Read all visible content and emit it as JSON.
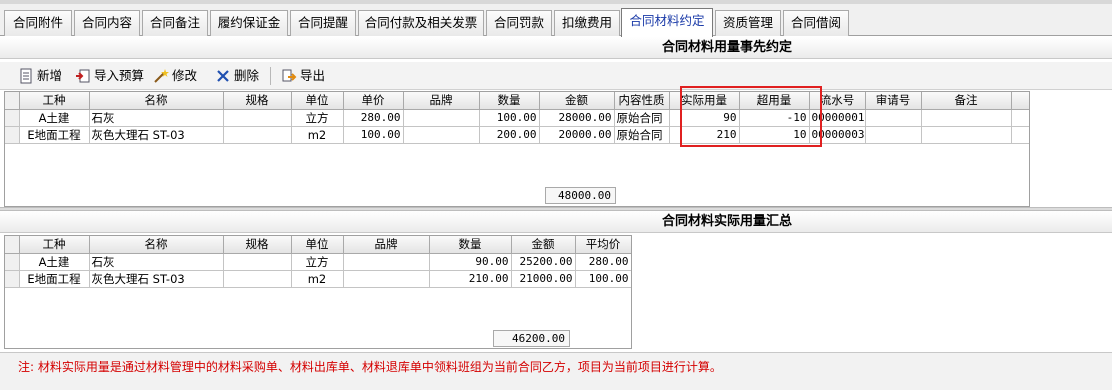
{
  "tabs": [
    {
      "label": "合同附件"
    },
    {
      "label": "合同内容"
    },
    {
      "label": "合同备注"
    },
    {
      "label": "履约保证金"
    },
    {
      "label": "合同提醒"
    },
    {
      "label": "合同付款及相关发票"
    },
    {
      "label": "合同罚款"
    },
    {
      "label": "扣缴费用"
    },
    {
      "label": "合同材料约定"
    },
    {
      "label": "资质管理"
    },
    {
      "label": "合同借阅"
    }
  ],
  "active_tab": "合同材料约定",
  "section1": {
    "title": "合同材料用量事先约定",
    "toolbar": {
      "add": "新增",
      "import_budget": "导入预算",
      "edit": "修改",
      "delete": "删除",
      "export": "导出"
    },
    "columns": [
      "工种",
      "名称",
      "规格",
      "单位",
      "单价",
      "品牌",
      "数量",
      "金额",
      "内容性质",
      "实际用量",
      "超用量",
      "流水号",
      "审请号",
      "备注"
    ],
    "rows": [
      {
        "trade": "A土建",
        "name": "石灰",
        "spec": "",
        "unit": "立方",
        "price": "280.00",
        "brand": "",
        "qty": "100.00",
        "amount": "28000.00",
        "nature": "原始合同",
        "actual": "90",
        "over": "-10",
        "serial": "00000001",
        "apply": "",
        "remark": ""
      },
      {
        "trade": "E地面工程",
        "name": "灰色大理石 ST-03",
        "spec": "",
        "unit": "m2",
        "price": "100.00",
        "brand": "",
        "qty": "200.00",
        "amount": "20000.00",
        "nature": "原始合同",
        "actual": "210",
        "over": "10",
        "serial": "00000003",
        "apply": "",
        "remark": ""
      }
    ],
    "total_amount": "48000.00"
  },
  "section2": {
    "title": "合同材料实际用量汇总",
    "columns": [
      "工种",
      "名称",
      "规格",
      "单位",
      "品牌",
      "数量",
      "金额",
      "平均价"
    ],
    "rows": [
      {
        "trade": "A土建",
        "name": "石灰",
        "spec": "",
        "unit": "立方",
        "brand": "",
        "qty": "90.00",
        "amount": "25200.00",
        "avg": "280.00"
      },
      {
        "trade": "E地面工程",
        "name": "灰色大理石 ST-03",
        "spec": "",
        "unit": "m2",
        "brand": "",
        "qty": "210.00",
        "amount": "21000.00",
        "avg": "100.00"
      }
    ],
    "total_amount": "46200.00"
  },
  "note": "注:  材料实际用量是通过材料管理中的材料采购单、材料出库单、材料退库单中领料班组为当前合同乙方，项目为当前项目进行计算。",
  "colors": {
    "highlight": "#e02020",
    "note_text": "#d40000",
    "active_tab_text": "#1a3aa8"
  }
}
